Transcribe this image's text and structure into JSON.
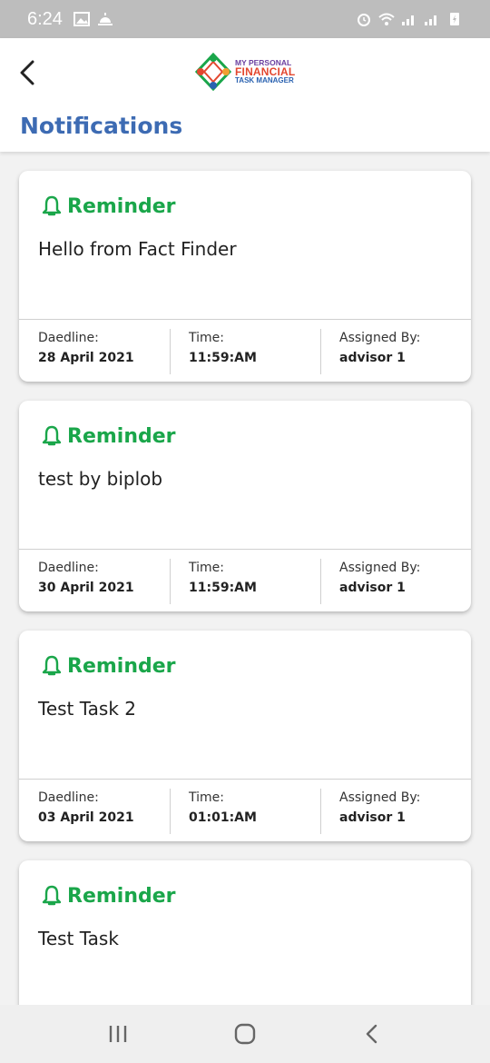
{
  "status_bar": {
    "time": "6:24"
  },
  "header": {
    "logo": {
      "line1": "MY PERSONAL",
      "line2": "FINANCIAL",
      "line3": "TASK MANAGER"
    },
    "title": "Notifications"
  },
  "colors": {
    "title": "#3d6bb3",
    "reminder": "#1aa64a"
  },
  "notifications": [
    {
      "heading": "Reminder",
      "message": "Hello from Fact Finder",
      "deadline_label": "Daedline:",
      "deadline": "28 April 2021",
      "time_label": "Time:",
      "time": "11:59:AM",
      "assigned_label": "Assigned By:",
      "assigned_by": "advisor 1"
    },
    {
      "heading": "Reminder",
      "message": "test by biplob",
      "deadline_label": "Daedline:",
      "deadline": "30 April 2021",
      "time_label": "Time:",
      "time": "11:59:AM",
      "assigned_label": "Assigned By:",
      "assigned_by": "advisor 1"
    },
    {
      "heading": "Reminder",
      "message": "Test Task 2",
      "deadline_label": "Daedline:",
      "deadline": "03 April 2021",
      "time_label": "Time:",
      "time": "01:01:AM",
      "assigned_label": "Assigned By:",
      "assigned_by": "advisor 1"
    },
    {
      "heading": "Reminder",
      "message": "Test Task"
    }
  ]
}
